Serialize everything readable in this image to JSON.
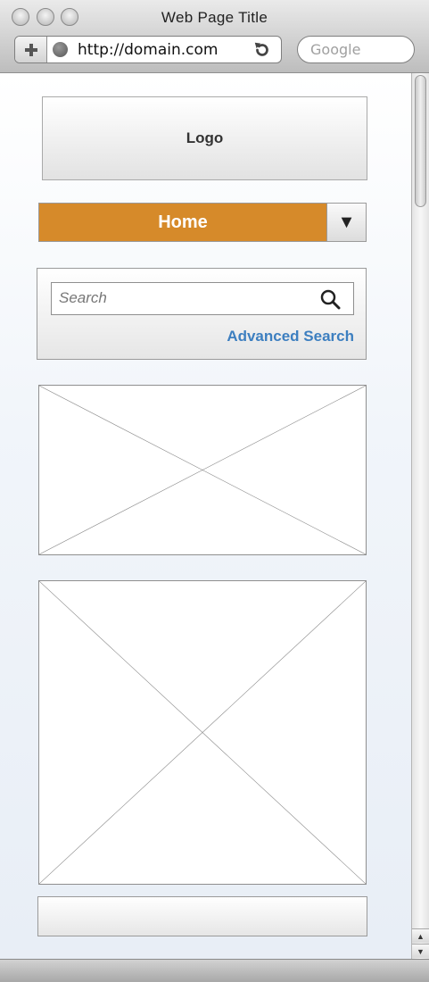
{
  "window": {
    "title": "Web Page Title"
  },
  "toolbar": {
    "url": "http://domain.com",
    "search_placeholder": "Google",
    "icons": [
      "plus-icon",
      "globe-icon",
      "reload-icon"
    ]
  },
  "page": {
    "logo_label": "Logo",
    "nav": {
      "home_label": "Home",
      "toggle_glyph": "▼",
      "accent_color": "#d68a2a"
    },
    "search": {
      "placeholder": "Search",
      "advanced_link": "Advanced Search",
      "link_color": "#3d7fc0"
    },
    "image_placeholders": 2
  }
}
